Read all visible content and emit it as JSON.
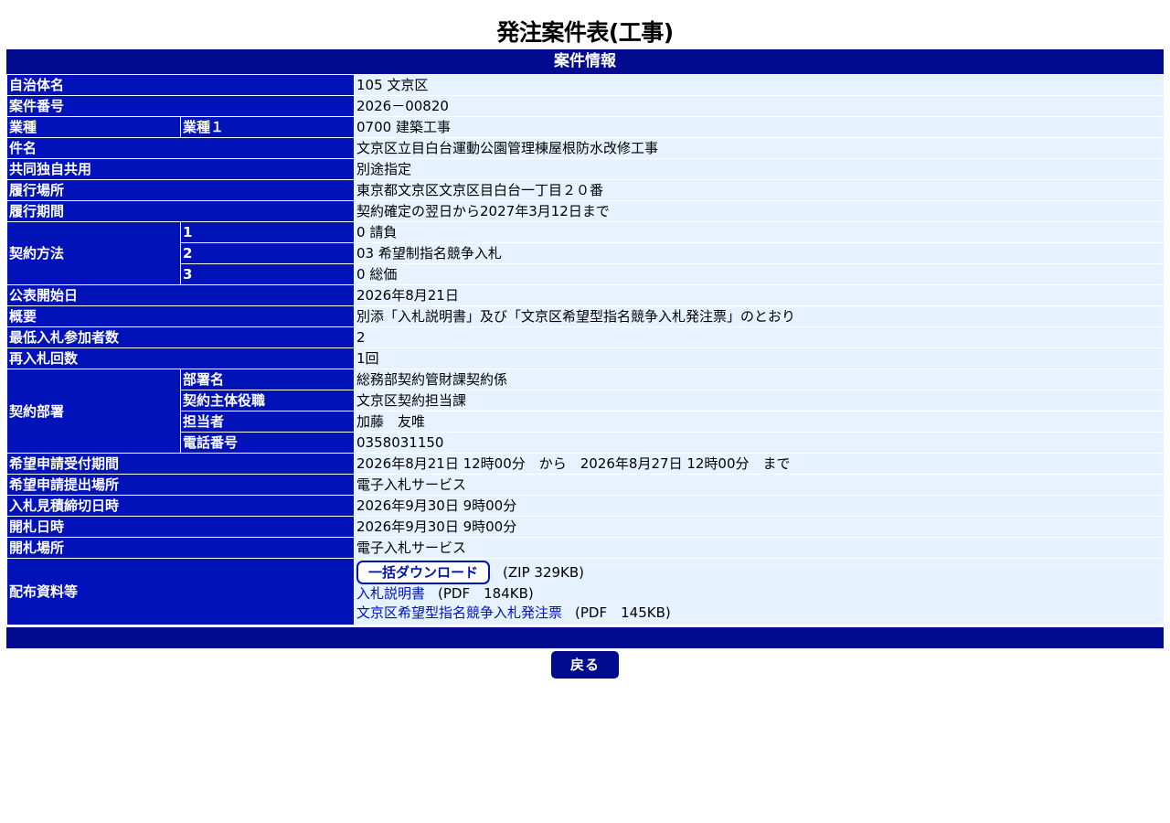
{
  "page_title": "発注案件表(工事)",
  "section_title": "案件情報",
  "rows": {
    "jichitai": {
      "label": "自治体名",
      "value": "105 文京区"
    },
    "anken_bango": {
      "label": "案件番号",
      "value": "2026－00820"
    },
    "gyoshu": {
      "label": "業種",
      "sublabel": "業種１",
      "value": "0700 建築工事"
    },
    "kenmei": {
      "label": "件名",
      "value": "文京区立目白台運動公園管理棟屋根防水改修工事"
    },
    "kyodo": {
      "label": "共同独自共用",
      "value": "別途指定"
    },
    "basho": {
      "label": "履行場所",
      "value": "東京都文京区文京区目白台一丁目２０番"
    },
    "kikan": {
      "label": "履行期間",
      "value": "契約確定の翌日から2027年3月12日まで"
    },
    "keiyaku_hoho": {
      "label": "契約方法",
      "items": [
        {
          "sublabel": "1",
          "value": "0 請負"
        },
        {
          "sublabel": "2",
          "value": "03 希望制指名競争入札"
        },
        {
          "sublabel": "3",
          "value": "0 総価"
        }
      ]
    },
    "kohyo": {
      "label": "公表開始日",
      "value": "2026年8月21日"
    },
    "gaiyo": {
      "label": "概要",
      "value": "別添「入札説明書」及び「文京区希望型指名競争入札発注票」のとおり"
    },
    "saitei": {
      "label": "最低入札参加者数",
      "value": "2"
    },
    "sainyusatsu": {
      "label": "再入札回数",
      "value": "1回"
    },
    "keiyaku_busho": {
      "label": "契約部署",
      "items": [
        {
          "sublabel": "部署名",
          "value": "総務部契約管財課契約係"
        },
        {
          "sublabel": "契約主体役職",
          "value": "文京区契約担当課"
        },
        {
          "sublabel": "担当者",
          "value": "加藤　友唯"
        },
        {
          "sublabel": "電話番号",
          "value": "0358031150"
        }
      ]
    },
    "uketsuke": {
      "label": "希望申請受付期間",
      "value": "2026年8月21日 12時00分　から　2026年8月27日 12時00分　まで"
    },
    "teishutsu": {
      "label": "希望申請提出場所",
      "value": "電子入札サービス"
    },
    "shimekiri": {
      "label": "入札見積締切日時",
      "value": "2026年9月30日 9時00分"
    },
    "kaisatsu_nichiji": {
      "label": "開札日時",
      "value": "2026年9月30日 9時00分"
    },
    "kaisatsu_basho": {
      "label": "開札場所",
      "value": "電子入札サービス"
    },
    "haifu": {
      "label": "配布資料等",
      "download_label": "一括ダウンロード",
      "download_meta": "(ZIP 329KB)",
      "files": [
        {
          "name": "入札説明書",
          "meta": "(PDF　184KB)"
        },
        {
          "name": "文京区希望型指名競争入札発注票",
          "meta": "(PDF　145KB)"
        }
      ]
    }
  },
  "back_label": "戻る"
}
